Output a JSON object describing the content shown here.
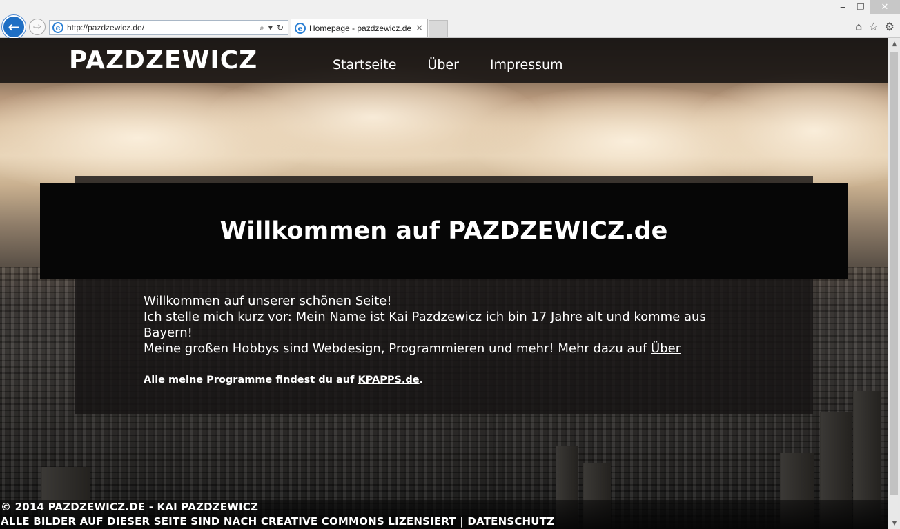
{
  "browser": {
    "address_url": "http://pazdzewicz.de/",
    "tab_title": "Homepage - pazdzewicz.de",
    "back_icon": "arrow-left-icon",
    "forward_icon": "arrow-right-icon",
    "search_glyph": "⌕",
    "dropdown_glyph": "▾",
    "refresh_glyph": "↻",
    "tab_close_glyph": "✕",
    "back_glyph": "←",
    "forward_glyph": "⇨",
    "ie_glyph": "e",
    "minimize_glyph": "‒",
    "restore_glyph": "❐",
    "close_glyph": "✕",
    "home_glyph": "⌂",
    "favorites_glyph": "☆",
    "settings_glyph": "⚙",
    "scroll_up_glyph": "▲",
    "scroll_down_glyph": "▼"
  },
  "site": {
    "brand": "PAZDZEWICZ",
    "nav": [
      {
        "label": "Startseite"
      },
      {
        "label": "Über"
      },
      {
        "label": "Impressum"
      }
    ],
    "welcome": {
      "title": "Willkommen auf PAZDZEWICZ.de",
      "line1": "Willkommen auf unserer schönen Seite!",
      "line2": "Ich stelle mich kurz vor: Mein Name ist Kai Pazdzewicz ich bin 17 Jahre alt und komme aus Bayern!",
      "line3_prefix": "Meine großen Hobbys sind Webdesign, Programmieren und mehr! Mehr dazu auf ",
      "line3_link": "Über",
      "programs_prefix": "Alle meine Programme findest du auf ",
      "programs_link": "KPAPPS.de",
      "programs_suffix": "."
    },
    "footer": {
      "copyright": "© 2014 PAZDZEWICZ.DE - KAI PAZDZEWICZ",
      "license_prefix": "ALLE BILDER AUF DIESER SEITE SIND NACH ",
      "license_link": "CREATIVE COMMONS",
      "license_suffix": " LIZENSIERT | ",
      "privacy_link": "DATENSCHUTZ"
    }
  },
  "colors": {
    "chrome_bg": "#f0f0f0",
    "back_button": "#1f6fc4",
    "header_bg": "#1c1816",
    "banner_bg": "#060606",
    "text": "#ffffff"
  }
}
